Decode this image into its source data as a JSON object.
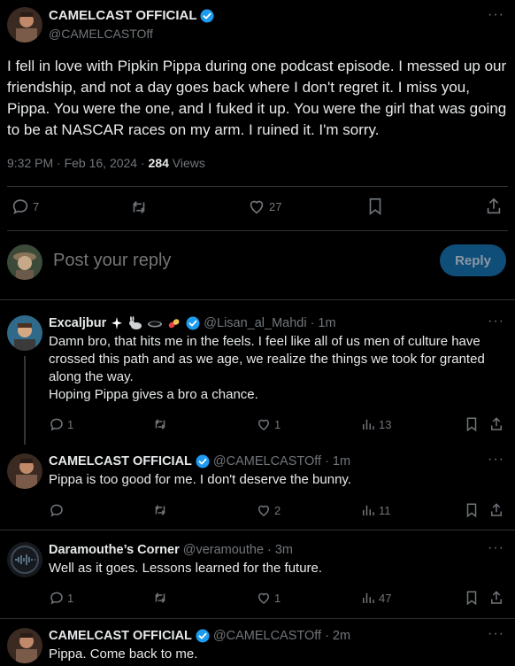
{
  "main_tweet": {
    "author_name": "CAMELCAST OFFICIAL",
    "author_handle": "@CAMELCASTOff",
    "text": "I fell in love with Pipkin Pippa during one podcast episode. I messed up our friendship, and not a day goes back where I don't regret it. I miss you, Pippa. You were the one, and I fuked it up. You were the girl that was going to be at NASCAR races on my arm. I ruined it. I'm sorry.",
    "time": "9:32 PM · Feb 16, 2024 · ",
    "views_count": "284",
    "views_label": " Views",
    "replies": "7",
    "likes": "27"
  },
  "composer": {
    "placeholder": "Post your reply",
    "button_label": "Reply"
  },
  "replies": [
    {
      "name": "Excaljbur",
      "handle": "@Lisan_al_Mahdi",
      "time": "· 1m",
      "text": "Damn bro, that hits me in the feels. I feel like all of us men of culture have crossed this path and as we age, we realize the things we took for granted along the way.\nHoping Pippa gives a bro a chance.",
      "replies": "1",
      "likes": "1",
      "views": "13"
    },
    {
      "name": "CAMELCAST OFFICIAL",
      "handle": "@CAMELCASTOff",
      "time": "· 1m",
      "text": "Pippa is too good for me. I don't deserve the bunny.",
      "replies": "",
      "likes": "2",
      "views": "11"
    },
    {
      "name": "Daramouthe’s Corner",
      "handle": "@veramouthe",
      "time": "· 3m",
      "text": "Well as it goes. Lessons learned for the future.",
      "replies": "1",
      "likes": "1",
      "views": "47"
    },
    {
      "name": "CAMELCAST OFFICIAL",
      "handle": "@CAMELCASTOff",
      "time": "· 2m",
      "text": "Pippa. Come back to me."
    }
  ],
  "colors": {
    "background": "#000000",
    "text": "#e7e9ea",
    "muted": "#71767b",
    "verified": "#1d9bf0",
    "reply_button": "#0f4e78"
  }
}
